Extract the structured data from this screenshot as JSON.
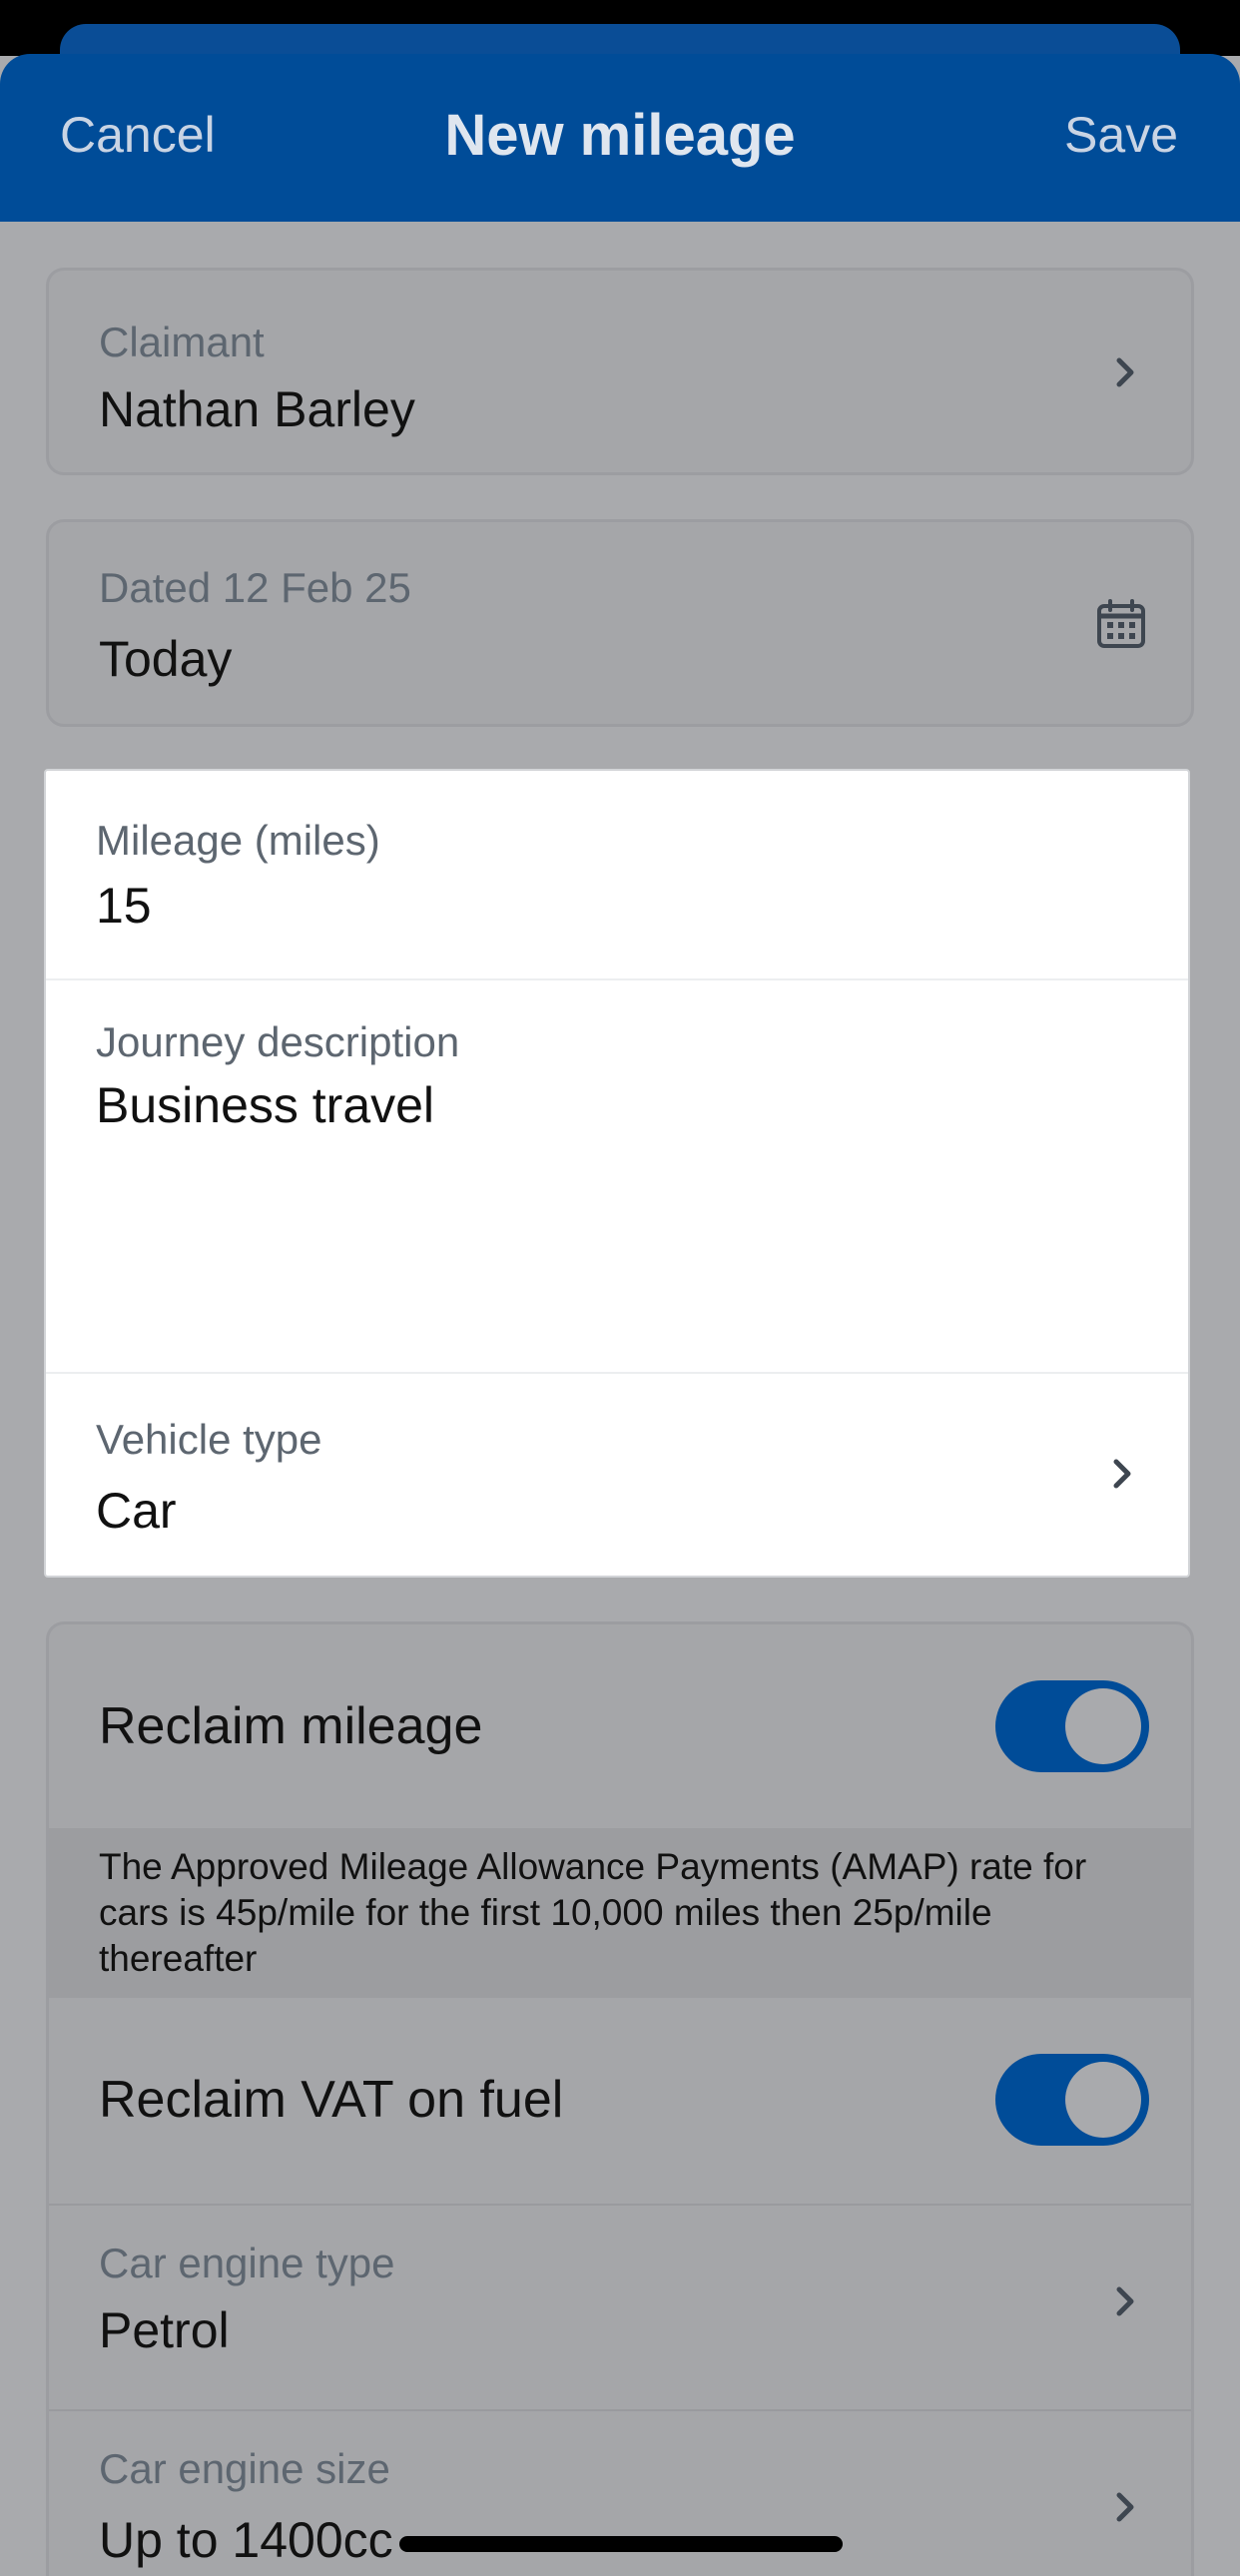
{
  "header": {
    "cancel_label": "Cancel",
    "title": "New mileage",
    "save_label": "Save"
  },
  "claimant": {
    "label": "Claimant",
    "value": "Nathan Barley"
  },
  "date": {
    "label": "Dated 12 Feb 25",
    "value": "Today"
  },
  "mileage": {
    "label": "Mileage (miles)",
    "value": "15"
  },
  "journey": {
    "label": "Journey description",
    "value": "Business travel"
  },
  "vehicle": {
    "label": "Vehicle type",
    "value": "Car"
  },
  "reclaim_mileage": {
    "label": "Reclaim mileage",
    "enabled": true,
    "info": "The Approved Mileage Allowance Payments (AMAP) rate for cars is 45p/mile for the first 10,000 miles then 25p/mile thereafter"
  },
  "reclaim_vat": {
    "label": "Reclaim VAT on fuel",
    "enabled": true
  },
  "engine_type": {
    "label": "Car engine type",
    "value": "Petrol"
  },
  "engine_size": {
    "label": "Car engine size",
    "value": "Up to 1400cc"
  },
  "colors": {
    "brand": "#004c98",
    "overlay": "#a9aaad"
  }
}
